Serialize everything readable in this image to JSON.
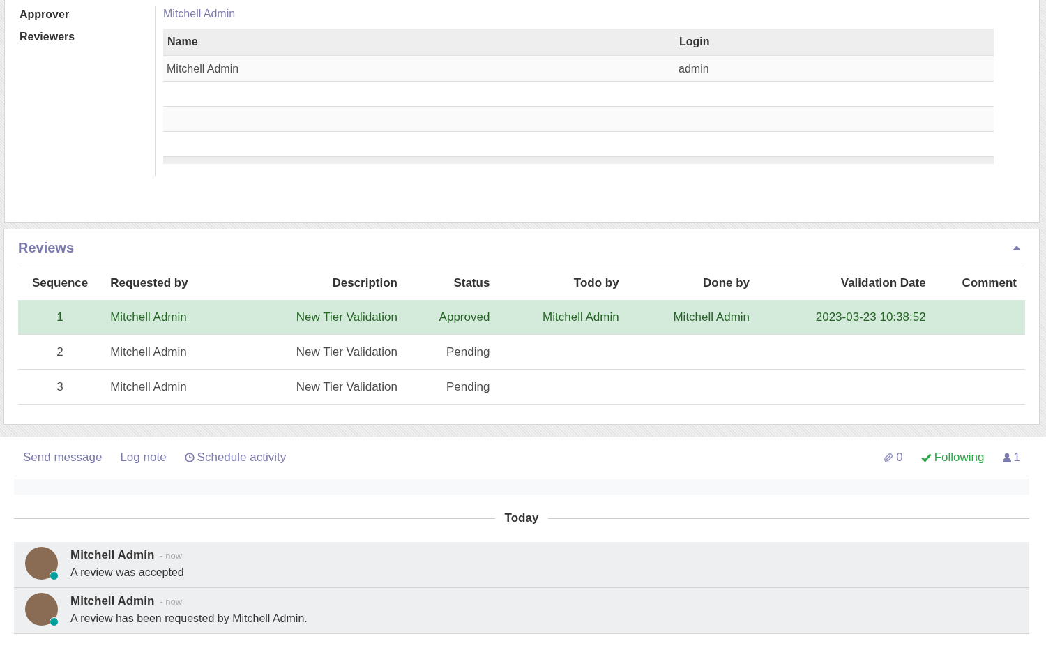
{
  "form": {
    "fields": [
      {
        "label": "Approver",
        "value": "Mitchell Admin"
      },
      {
        "label": "Reviewers"
      }
    ],
    "reviewers_table": {
      "columns": [
        "Name",
        "Login"
      ],
      "rows": [
        [
          "Mitchell Admin",
          "admin"
        ]
      ]
    }
  },
  "reviews": {
    "title": "Reviews",
    "expanded": true,
    "columns": [
      "Sequence",
      "Requested by",
      "Description",
      "Status",
      "Todo by",
      "Done by",
      "Validation Date",
      "Comment"
    ],
    "rows": [
      {
        "kind": "approved",
        "cells": [
          "1",
          "Mitchell Admin",
          "New Tier Validation",
          "Approved",
          "Mitchell Admin",
          "Mitchell Admin",
          "2023-03-23 10:38:52",
          ""
        ]
      },
      {
        "kind": "pending",
        "cells": [
          "2",
          "Mitchell Admin",
          "New Tier Validation",
          "Pending",
          "",
          "",
          "",
          ""
        ]
      },
      {
        "kind": "pending",
        "cells": [
          "3",
          "Mitchell Admin",
          "New Tier Validation",
          "Pending",
          "",
          "",
          "",
          ""
        ]
      }
    ]
  },
  "chatter": {
    "send_message": "Send message",
    "log_note": "Log note",
    "schedule_activity": "Schedule activity",
    "attachments": "0",
    "following": "Following",
    "followers": "1",
    "separator": "Today",
    "messages": [
      {
        "author": "Mitchell Admin",
        "time": "- now",
        "body": "A review was accepted",
        "online": true
      },
      {
        "author": "Mitchell Admin",
        "time": "- now",
        "body": "A review has been requested by Mitchell Admin.",
        "online": true
      }
    ]
  }
}
